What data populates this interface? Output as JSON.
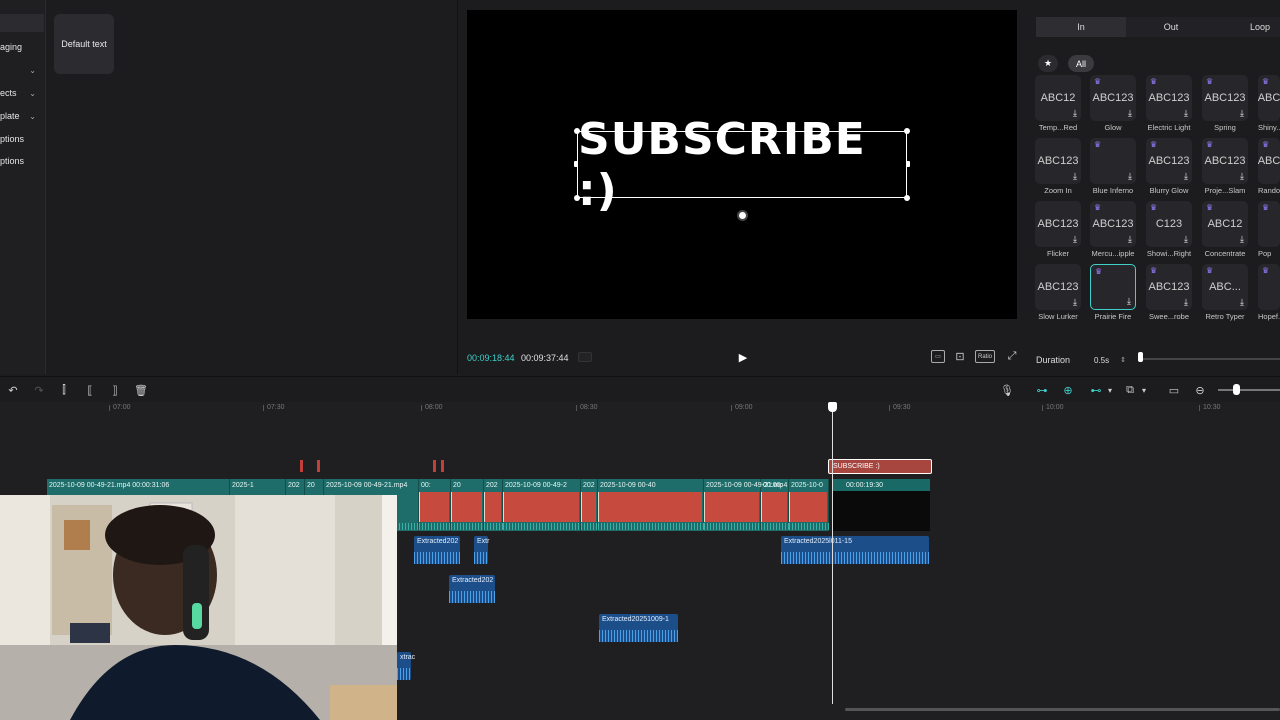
{
  "sidebar": {
    "items": [
      {
        "label": "",
        "chevron": false,
        "active": true
      },
      {
        "label": "aging",
        "chevron": false
      },
      {
        "label": "",
        "chevron": true
      },
      {
        "label": "ects",
        "chevron": true
      },
      {
        "label": "plate",
        "chevron": true
      },
      {
        "label": "ptions",
        "chevron": false
      },
      {
        "label": "ptions",
        "chevron": false
      }
    ]
  },
  "text_panel": {
    "default_text_label": "Default text"
  },
  "preview": {
    "overlay_text": "SUBSCRIBE :)",
    "current_time": "00:09:18:44",
    "total_time": "00:09:37:44",
    "ratio_label": "Ratio"
  },
  "animation_panel": {
    "tabs": [
      {
        "label": "In",
        "active": true
      },
      {
        "label": "Out",
        "active": false
      },
      {
        "label": "Loop",
        "active": false
      }
    ],
    "fav_label": "★",
    "all_label": "All",
    "cards": [
      {
        "preview": "ABC12",
        "label": "Temp...Red"
      },
      {
        "preview": "ABC123",
        "label": "Glow"
      },
      {
        "preview": "ABC123",
        "label": "Electric Light"
      },
      {
        "preview": "ABC123",
        "label": "Spring"
      },
      {
        "preview": "ABC",
        "label": "Shiny..."
      },
      {
        "preview": "ABC123",
        "label": "Zoom In"
      },
      {
        "preview": "",
        "label": "Blue Inferno"
      },
      {
        "preview": "ABC123",
        "label": "Blurry Glow"
      },
      {
        "preview": "ABC123",
        "label": "Proje...Slam"
      },
      {
        "preview": "ABC",
        "label": "Rando..."
      },
      {
        "preview": "ABC123",
        "label": "Flicker"
      },
      {
        "preview": "ABC123",
        "label": "Mercu...ipple"
      },
      {
        "preview": "C123",
        "label": "Showi...Right"
      },
      {
        "preview": "ABC12",
        "label": "Concentrate"
      },
      {
        "preview": "",
        "label": "Pop"
      },
      {
        "preview": "ABC123",
        "label": "Slow Lurker"
      },
      {
        "preview": "",
        "label": "Prairie Fire"
      },
      {
        "preview": "ABC123",
        "label": "Swee...robe"
      },
      {
        "preview": "ABC...",
        "label": "Retro Typer"
      },
      {
        "preview": "",
        "label": "Hopef..."
      }
    ],
    "duration_label": "Duration",
    "duration_value": "0.5s",
    "duration_fraction": 0.0
  },
  "timeline": {
    "ruler": [
      "07:00",
      "07:30",
      "08:00",
      "08:30",
      "09:00",
      "09:30",
      "10:00",
      "10:30"
    ],
    "text_clip_label": "SUBSCRIBE :)",
    "video_clips": [
      {
        "label": "2025-10-09 00-49-21.mp4   00:00:31:06"
      },
      {
        "label": "2025-1"
      },
      {
        "label": "202"
      },
      {
        "label": "20"
      },
      {
        "label": "2025-10-09 00-49-21.mp4"
      },
      {
        "label": "00:"
      },
      {
        "label": "20"
      },
      {
        "label": "202"
      },
      {
        "label": "2025-10-09 00-49-2"
      },
      {
        "label": "202"
      },
      {
        "label": "2025-10-09 00-40"
      },
      {
        "label": "2025-10-09 00-49-21.mp4"
      },
      {
        "label": "00:00:"
      },
      {
        "label": "2025-10-0"
      }
    ],
    "black_clip_label": "00:00:19:30",
    "audio_clips": [
      {
        "label": "Extracted202"
      },
      {
        "label": "Extr"
      },
      {
        "label": "Extracted2025l011-15"
      },
      {
        "label": "Extracted202"
      },
      {
        "label": "Extracted20251009-1"
      },
      {
        "label": "xtrac"
      }
    ]
  },
  "colors": {
    "accent": "#3fd0c9",
    "text_clip": "#a6463f",
    "video_track": "#1e6d6a",
    "audio_track": "#1c4f8a"
  }
}
